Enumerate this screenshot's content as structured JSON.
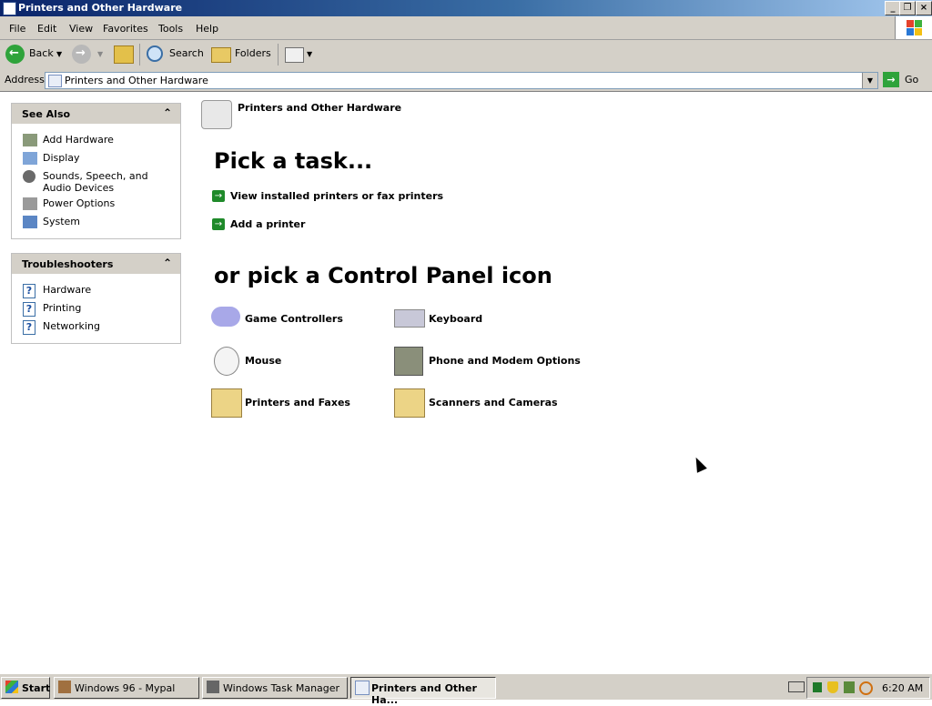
{
  "window": {
    "title": "Printers and Other Hardware"
  },
  "menu": [
    "File",
    "Edit",
    "View",
    "Favorites",
    "Tools",
    "Help"
  ],
  "toolbar": {
    "back": "Back",
    "search": "Search",
    "folders": "Folders"
  },
  "address": {
    "label": "Address",
    "value": "Printers and Other Hardware",
    "go": "Go"
  },
  "see_also": {
    "title": "See Also",
    "items": [
      "Add Hardware",
      "Display",
      "Sounds, Speech, and Audio Devices",
      "Power Options",
      "System"
    ]
  },
  "troubleshooters": {
    "title": "Troubleshooters",
    "items": [
      "Hardware",
      "Printing",
      "Networking"
    ]
  },
  "content": {
    "header": "Printers and Other Hardware",
    "pick_task": "Pick a task...",
    "tasks": [
      "View installed printers or fax printers",
      "Add a printer"
    ],
    "pick_icon": "or pick a Control Panel icon",
    "icons": [
      "Game Controllers",
      "Keyboard",
      "Mouse",
      "Phone and Modem Options",
      "Printers and Faxes",
      "Scanners and Cameras"
    ]
  },
  "taskbar": {
    "start": "Start",
    "buttons": [
      "Windows 96 - Mypal",
      "Windows Task Manager",
      "Printers and Other Ha..."
    ],
    "clock": "6:20 AM"
  }
}
